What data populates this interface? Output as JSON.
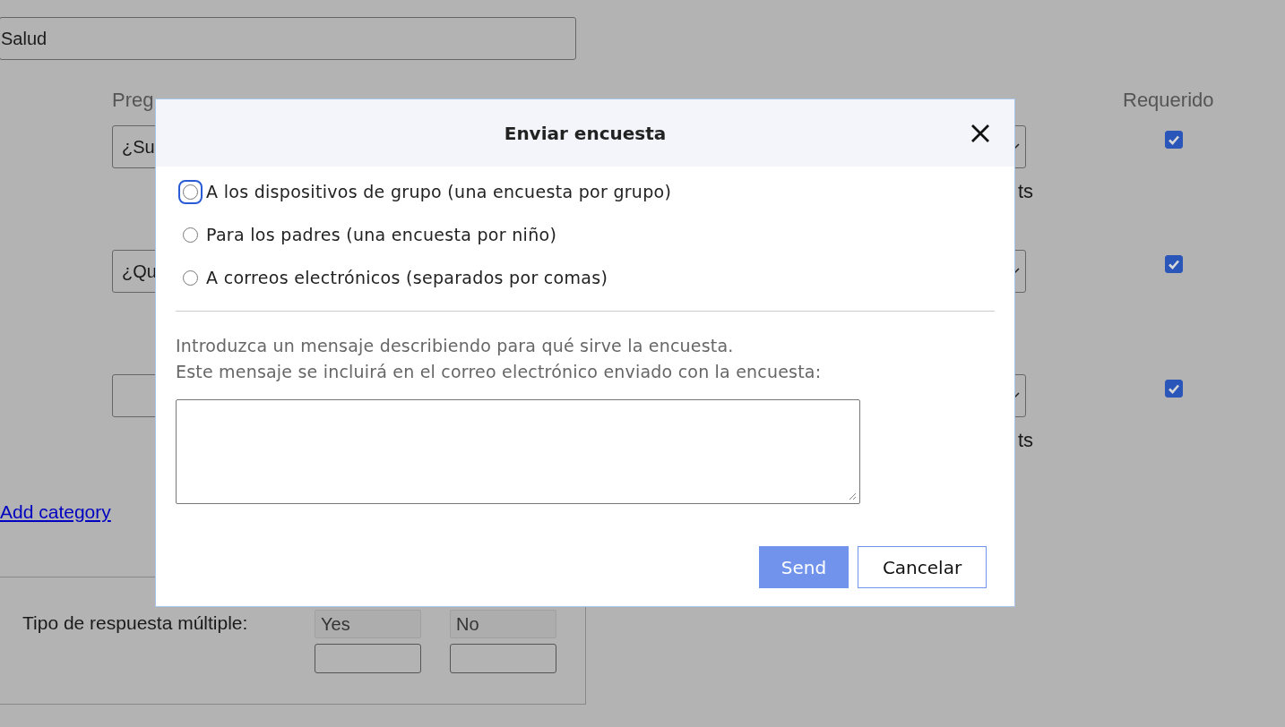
{
  "page": {
    "category_field": {
      "value": "Salud"
    },
    "headers": {
      "question": "Preg",
      "required": "Requerido"
    },
    "rows": [
      {
        "question": "¿Su",
        "suffix": "ts",
        "required": true
      },
      {
        "question": "¿Qu",
        "required": true
      },
      {
        "required": true,
        "suffix": "ts"
      }
    ],
    "add_category": "Add category",
    "multiple": {
      "label": "Tipo de respuesta múltiple:",
      "options": [
        {
          "value": "Yes"
        },
        {
          "value": "No"
        }
      ]
    }
  },
  "dialog": {
    "title": "Enviar encuesta",
    "options": [
      {
        "label": "A los dispositivos de grupo (una encuesta por grupo)",
        "selected": false,
        "focused": true
      },
      {
        "label": "Para los padres (una encuesta por niño)",
        "selected": false,
        "focused": false
      },
      {
        "label": "A correos electrónicos (separados por comas)",
        "selected": false,
        "focused": false
      }
    ],
    "instructions": [
      "Introduzca un mensaje describiendo para qué sirve la encuesta.",
      "Este mensaje se incluirá en el correo electrónico enviado con la encuesta:"
    ],
    "buttons": [
      {
        "label": "Send",
        "kind": "primary"
      },
      {
        "label": "Cancelar",
        "kind": "secondary"
      }
    ]
  }
}
